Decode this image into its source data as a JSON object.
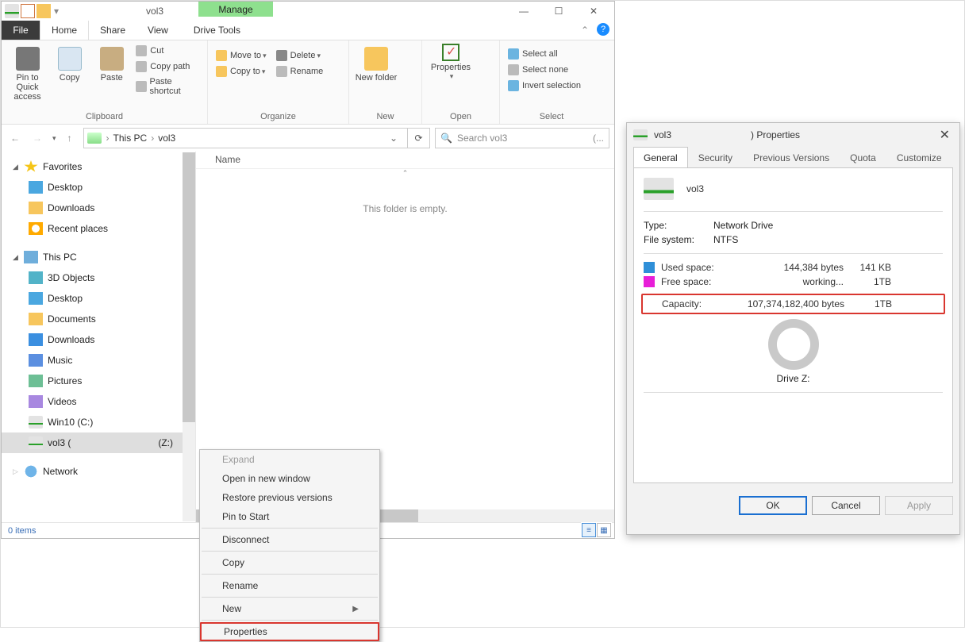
{
  "explorer": {
    "manage_label": "Manage",
    "title": "vol3",
    "file_tab": "File",
    "tabs": [
      "Home",
      "Share",
      "View"
    ],
    "drive_tools_tab": "Drive Tools",
    "ribbon": {
      "clipboard": {
        "group": "Clipboard",
        "pin": "Pin to Quick access",
        "copy": "Copy",
        "paste": "Paste",
        "cut": "Cut",
        "copy_path": "Copy path",
        "paste_shortcut": "Paste shortcut"
      },
      "organize": {
        "group": "Organize",
        "move_to": "Move to",
        "copy_to": "Copy to",
        "delete": "Delete",
        "rename": "Rename"
      },
      "new": {
        "group": "New",
        "new_folder": "New folder"
      },
      "open": {
        "group": "Open",
        "properties": "Properties"
      },
      "select": {
        "group": "Select",
        "all": "Select all",
        "none": "Select none",
        "invert": "Invert selection"
      }
    },
    "breadcrumb": [
      "This PC",
      "vol3"
    ],
    "search_placeholder": "Search vol3",
    "nav": {
      "favorites": "Favorites",
      "fav_items": [
        "Desktop",
        "Downloads",
        "Recent places"
      ],
      "this_pc": "This PC",
      "pc_items": [
        "3D Objects",
        "Desktop",
        "Documents",
        "Downloads",
        "Music",
        "Pictures",
        "Videos",
        "Win10 (C:)"
      ],
      "vol_item": "vol3 (",
      "vol_drive": "(Z:)",
      "network": "Network"
    },
    "column_name": "Name",
    "empty_text": "This folder is empty.",
    "status_items": "0 items"
  },
  "context_menu": {
    "items": [
      {
        "label": "Expand",
        "disabled": true
      },
      {
        "label": "Open in new window"
      },
      {
        "label": "Restore previous versions"
      },
      {
        "label": "Pin to Start"
      },
      {
        "sep": true
      },
      {
        "label": "Disconnect"
      },
      {
        "sep": true
      },
      {
        "label": "Copy"
      },
      {
        "sep": true
      },
      {
        "label": "Rename"
      },
      {
        "sep": true
      },
      {
        "label": "New",
        "submenu": true
      },
      {
        "sep": true
      },
      {
        "label": "Properties",
        "highlight": true
      }
    ]
  },
  "properties": {
    "title": ") Properties",
    "title_prefix": "vol3",
    "tabs": [
      "General",
      "Security",
      "Previous Versions",
      "Quota",
      "Customize"
    ],
    "drive_name": "vol3",
    "type_label": "Type:",
    "type_value": "Network Drive",
    "fs_label": "File system:",
    "fs_value": "NTFS",
    "used_label": "Used space:",
    "used_bytes": "144,384 bytes",
    "used_size": "141 KB",
    "free_label": "Free space:",
    "free_bytes": "working...",
    "free_size": "1TB",
    "cap_label": "Capacity:",
    "cap_bytes": "107,374,182,400 bytes",
    "cap_size": "1TB",
    "drive_z": "Drive Z:",
    "ok": "OK",
    "cancel": "Cancel",
    "apply": "Apply"
  }
}
